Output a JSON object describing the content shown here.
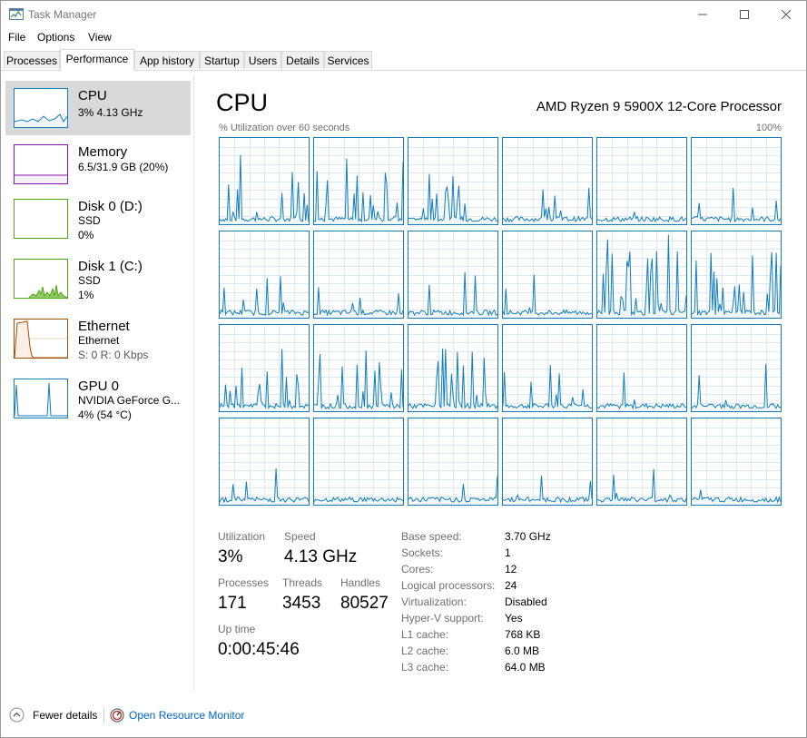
{
  "window": {
    "title": "Task Manager"
  },
  "menu": [
    "File",
    "Options",
    "View"
  ],
  "tabs": [
    "Processes",
    "Performance",
    "App history",
    "Startup",
    "Users",
    "Details",
    "Services"
  ],
  "active_tab": "Performance",
  "sidebar": {
    "items": [
      {
        "title": "CPU",
        "line1": "3% 4.13 GHz",
        "line2": "",
        "color": "#117dbb",
        "selected": true
      },
      {
        "title": "Memory",
        "line1": "6.5/31.9 GB (20%)",
        "line2": "",
        "color": "#8b12ae",
        "selected": false
      },
      {
        "title": "Disk 0 (D:)",
        "line1": "SSD",
        "line2": "0%",
        "color": "#4da60c",
        "selected": false
      },
      {
        "title": "Disk 1 (C:)",
        "line1": "SSD",
        "line2": "1%",
        "color": "#4da60c",
        "selected": false
      },
      {
        "title": "Ethernet",
        "line1": "Ethernet",
        "line2": "S: 0 R: 0 Kbps",
        "color": "#a74f01",
        "selected": false
      },
      {
        "title": "GPU 0",
        "line1": "NVIDIA GeForce G...",
        "line2": "4% (54 °C)",
        "color": "#117dbb",
        "selected": false
      }
    ]
  },
  "main": {
    "title": "CPU",
    "processor": "AMD Ryzen 9 5900X 12-Core Processor",
    "graph_label": "% Utilization over 60 seconds",
    "graph_max": "100%",
    "logical_graphs": 24
  },
  "stats": {
    "utilization": {
      "label": "Utilization",
      "value": "3%"
    },
    "speed": {
      "label": "Speed",
      "value": "4.13 GHz"
    },
    "processes": {
      "label": "Processes",
      "value": "171"
    },
    "threads": {
      "label": "Threads",
      "value": "3453"
    },
    "handles": {
      "label": "Handles",
      "value": "80527"
    },
    "uptime": {
      "label": "Up time",
      "value": "0:00:45:46"
    }
  },
  "specs": [
    {
      "label": "Base speed:",
      "value": "3.70 GHz"
    },
    {
      "label": "Sockets:",
      "value": "1"
    },
    {
      "label": "Cores:",
      "value": "12"
    },
    {
      "label": "Logical processors:",
      "value": "24"
    },
    {
      "label": "Virtualization:",
      "value": "Disabled"
    },
    {
      "label": "Hyper-V support:",
      "value": "Yes"
    },
    {
      "label": "L1 cache:",
      "value": "768 KB"
    },
    {
      "label": "L2 cache:",
      "value": "6.0 MB"
    },
    {
      "label": "L3 cache:",
      "value": "64.0 MB"
    }
  ],
  "footer": {
    "fewer_details": "Fewer details",
    "open_monitor": "Open Resource Monitor"
  },
  "colors": {
    "cpu_line": "#117dbb",
    "cpu_fill": "#f1f6fa",
    "grid": "#d9eaf4",
    "link": "#0066cc"
  }
}
